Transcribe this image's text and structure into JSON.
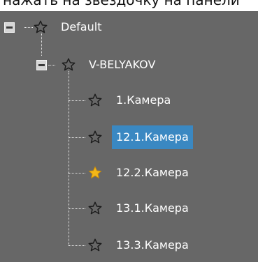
{
  "partial_caption": "нажать на звездочку на панели",
  "tree": {
    "root": {
      "label": "Default",
      "expanded": true,
      "favorite": false
    },
    "server": {
      "label": "V-BELYAKOV",
      "expanded": true,
      "favorite": false
    },
    "cameras": [
      {
        "label": "1.Камера",
        "favorite": false,
        "selected": false
      },
      {
        "label": "12.1.Камера",
        "favorite": false,
        "selected": true
      },
      {
        "label": "12.2.Камера",
        "favorite": true,
        "selected": false
      },
      {
        "label": "13.1.Камера",
        "favorite": false,
        "selected": false
      },
      {
        "label": "13.3.Камера",
        "favorite": false,
        "selected": false
      }
    ]
  },
  "colors": {
    "background": "#676767",
    "selection": "#3a88c2",
    "favorite_star": "#f3b718",
    "outline_star": "#1c1c1c"
  },
  "icons": {
    "toggle": "collapse-icon",
    "star_empty": "star-outline-icon",
    "star_filled": "star-filled-icon"
  }
}
